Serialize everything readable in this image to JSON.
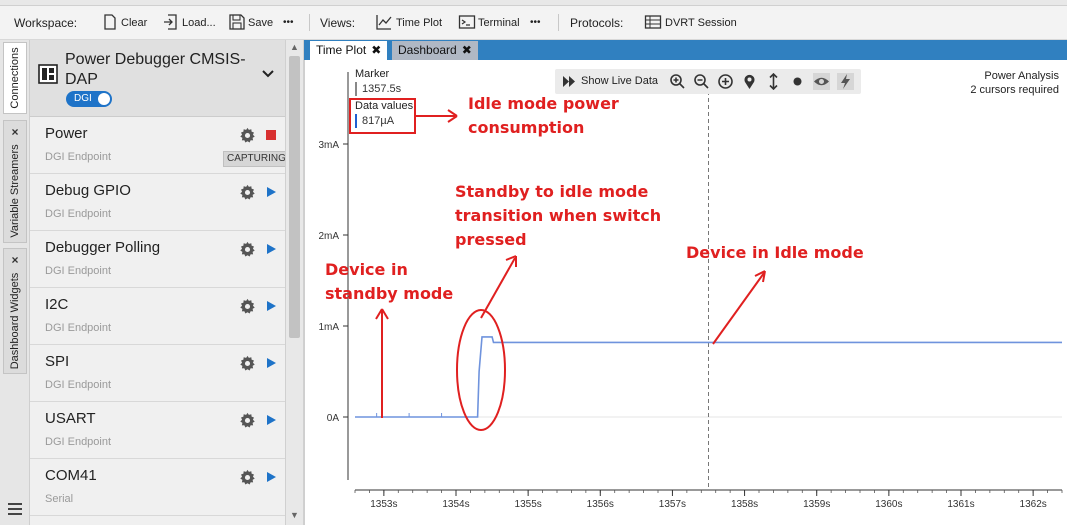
{
  "toolbar": {
    "workspace_label": "Workspace:",
    "clear": "Clear",
    "load": "Load...",
    "save": "Save",
    "more1": "•••",
    "views_label": "Views:",
    "time_plot": "Time Plot",
    "terminal": "Terminal",
    "more2": "•••",
    "protocols_label": "Protocols:",
    "dvrt_session": "DVRT Session"
  },
  "side_tabs": {
    "connections": "Connections",
    "variable_streamers": "Variable Streamers",
    "dashboard_widgets": "Dashboard Widgets",
    "close_glyph": "×"
  },
  "device": {
    "name": "Power Debugger CMSIS-DAP",
    "badge": "DGI"
  },
  "endpoints": [
    {
      "name": "Power",
      "sub": "DGI Endpoint",
      "badge": "CAPTURING",
      "state": "stop"
    },
    {
      "name": "Debug GPIO",
      "sub": "DGI Endpoint",
      "state": "play"
    },
    {
      "name": "Debugger Polling",
      "sub": "DGI Endpoint",
      "state": "play"
    },
    {
      "name": "I2C",
      "sub": "DGI Endpoint",
      "state": "play"
    },
    {
      "name": "SPI",
      "sub": "DGI Endpoint",
      "state": "play"
    },
    {
      "name": "USART",
      "sub": "DGI Endpoint",
      "state": "play"
    },
    {
      "name": "COM41",
      "sub": "Serial",
      "state": "play"
    }
  ],
  "doc_tabs": [
    {
      "label": "Time Plot",
      "close": "✖",
      "active": true
    },
    {
      "label": "Dashboard",
      "close": "✖",
      "active": false
    }
  ],
  "plot": {
    "marker_label": "Marker",
    "marker_value": "1357.5s",
    "data_values_label": "Data values",
    "data_value": "817µA",
    "show_live_data": "Show Live Data",
    "power_analysis_title": "Power Analysis",
    "power_analysis_sub": "2 cursors required"
  },
  "chart_data": {
    "type": "line",
    "y_ticks": [
      "3mA",
      "2mA",
      "1mA",
      "0A"
    ],
    "y_tick_values": [
      3,
      2,
      1,
      0
    ],
    "y_unit": "mA",
    "ylim": [
      0,
      3.1
    ],
    "x_ticks": [
      "1353s",
      "1354s",
      "1355s",
      "1356s",
      "1357s",
      "1358s",
      "1359s",
      "1360s",
      "1361s",
      "1362s"
    ],
    "x_tick_values": [
      1353,
      1354,
      1355,
      1356,
      1357,
      1358,
      1359,
      1360,
      1361,
      1362
    ],
    "xlim": [
      1352.6,
      1362.4
    ],
    "cursor_x": 1357.5,
    "series": [
      {
        "color": "#6f93dd",
        "x": [
          1352.6,
          1354.3,
          1354.32,
          1354.36,
          1354.5,
          1354.52,
          1362.4
        ],
        "y": [
          0.0,
          0.0,
          0.5,
          0.88,
          0.88,
          0.82,
          0.82
        ]
      }
    ],
    "grid": false
  },
  "annotations": {
    "idle_power_1": "Idle mode power",
    "idle_power_2": "consumption",
    "transition_1": "Standby to idle mode",
    "transition_2": "transition when switch",
    "transition_3": "pressed",
    "standby_1": "Device in",
    "standby_2": "standby mode",
    "idle_mode": "Device in Idle mode",
    "color": "#e02020"
  }
}
